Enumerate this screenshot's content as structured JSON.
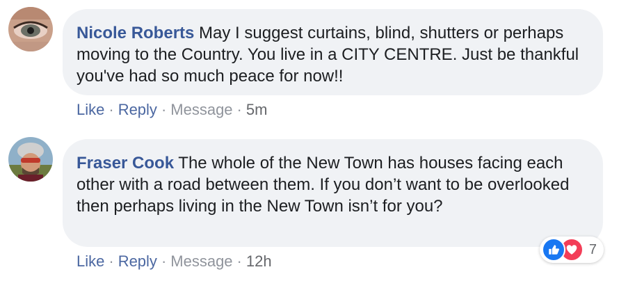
{
  "comments": [
    {
      "author": "Nicole Roberts",
      "text": "May I suggest curtains, blind, shutters or perhaps moving to the Country. You live in a CITY CENTRE. Just be thankful you've had so much peace for now!!",
      "actions": {
        "like": "Like",
        "reply": "Reply",
        "message": "Message",
        "time": "5m"
      }
    },
    {
      "author": "Fraser Cook",
      "text": "The whole of the New Town has houses facing each other with a road between them. If you don’t want to be overlooked then perhaps living in the New Town isn’t for you?",
      "actions": {
        "like": "Like",
        "reply": "Reply",
        "message": "Message",
        "time": "12h"
      },
      "reactions": {
        "icons": [
          "like-icon",
          "love-icon"
        ],
        "count": "7"
      }
    }
  ],
  "separator": "·",
  "colors": {
    "author": "#385898",
    "bubble": "#f0f2f5",
    "action": "#4b67a1",
    "meta": "#90949c"
  }
}
